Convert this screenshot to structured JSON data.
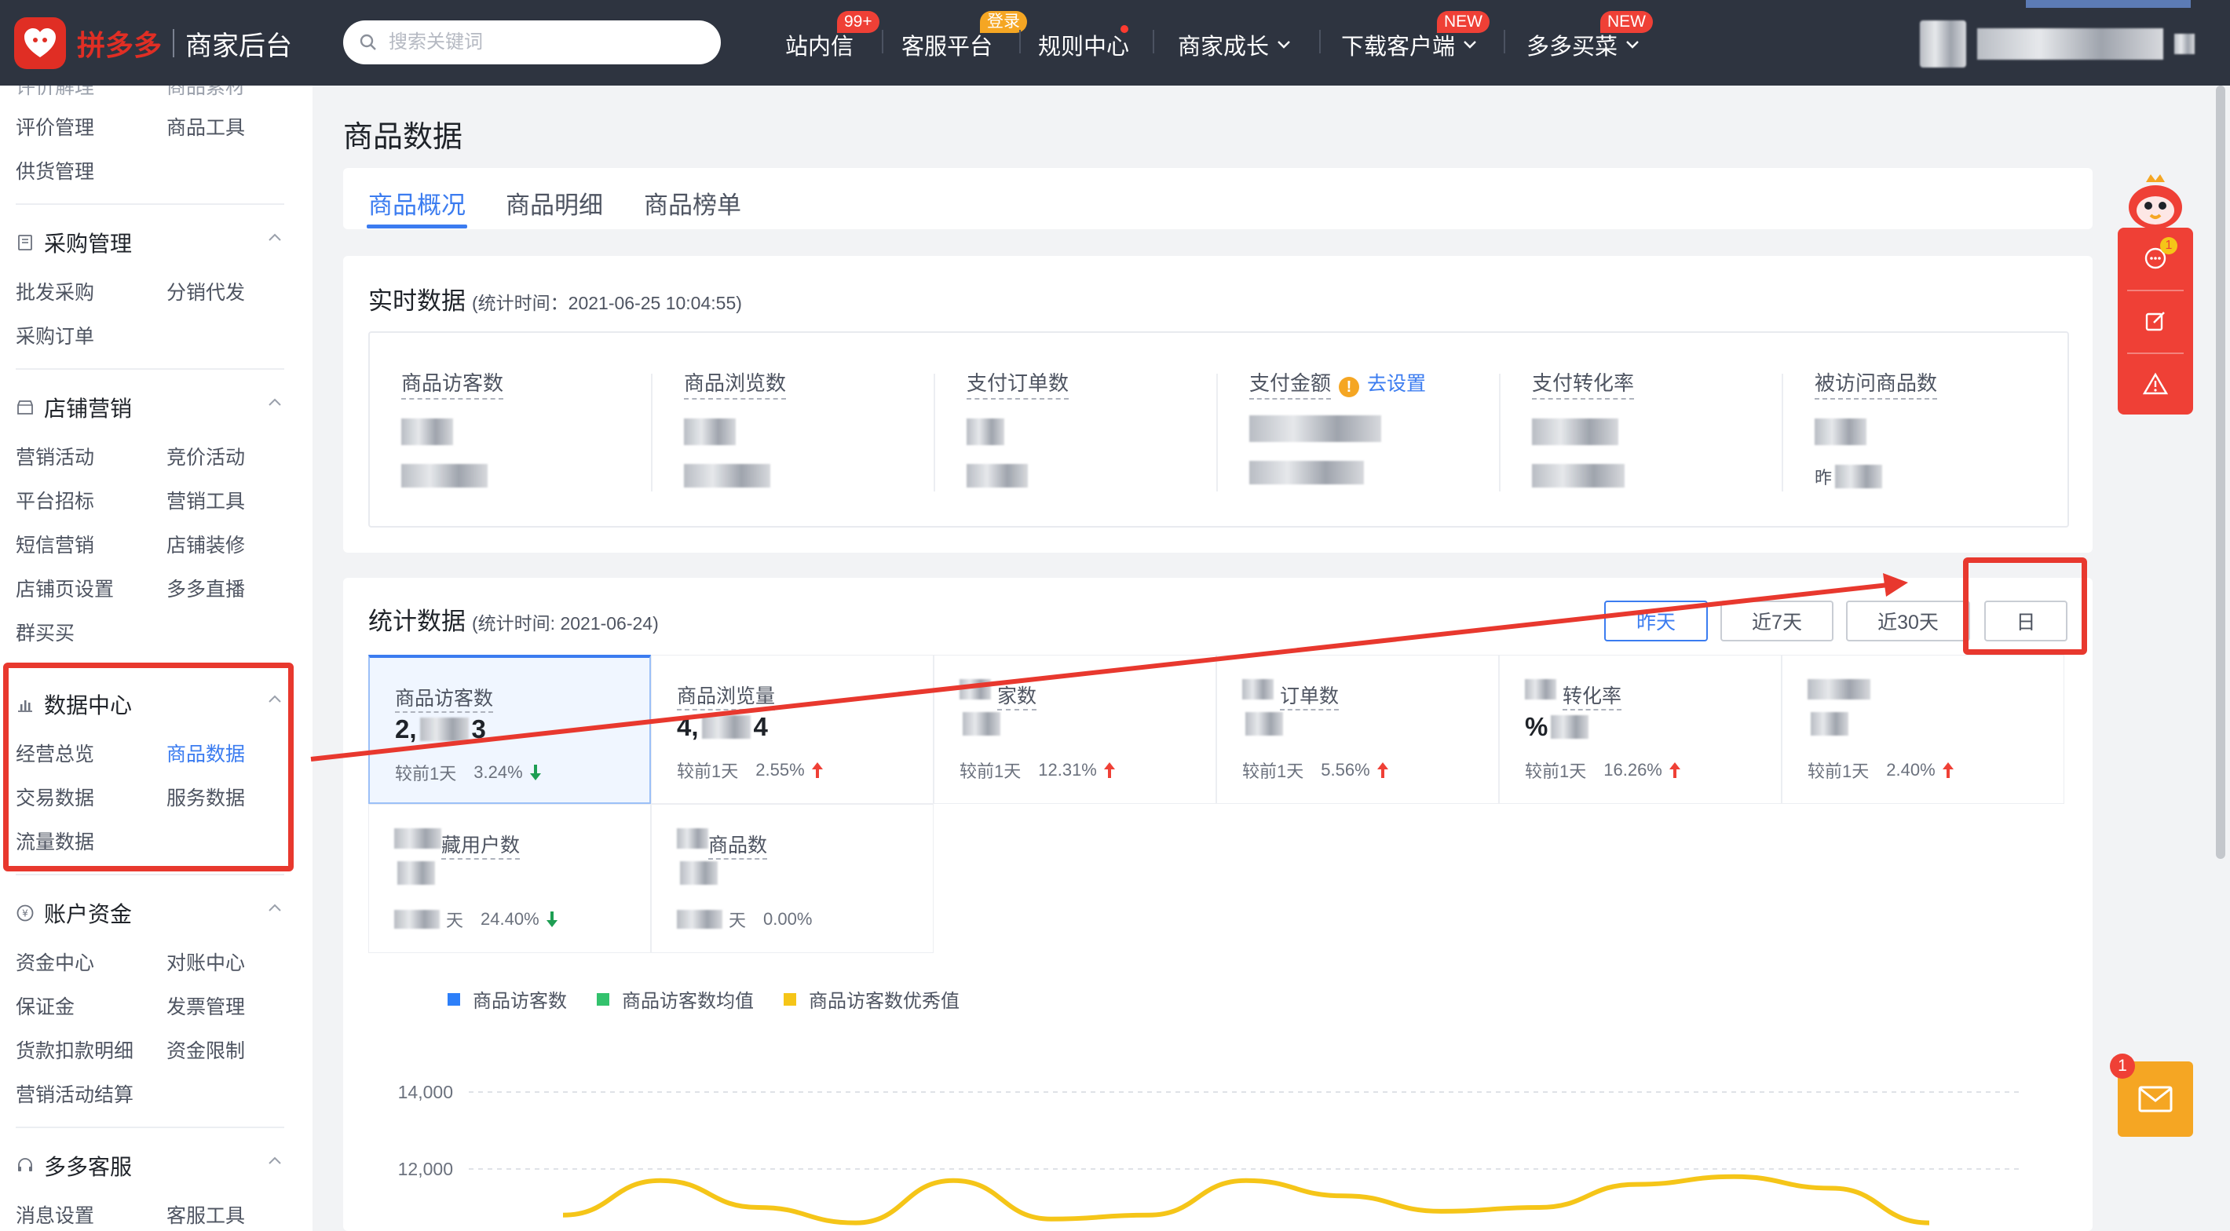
{
  "header": {
    "brand_name": "拼多多",
    "brand_sub": "商家后台",
    "search_placeholder": "搜索关键词",
    "nav": [
      {
        "label": "站内信",
        "badge": "99+"
      },
      {
        "label": "客服平台",
        "badge": "登录"
      },
      {
        "label": "规则中心"
      },
      {
        "label": "商家成长"
      },
      {
        "label": "下载客户端",
        "badge": "NEW"
      },
      {
        "label": "多多买菜",
        "badge": "NEW"
      }
    ]
  },
  "sidebar": {
    "top_rows": [
      [
        "评价管理",
        "商品工具"
      ],
      [
        "供货管理",
        ""
      ]
    ],
    "sections": [
      {
        "title": "采购管理",
        "rows": [
          [
            "批发采购",
            "分销代发"
          ],
          [
            "采购订单",
            ""
          ]
        ]
      },
      {
        "title": "店铺营销",
        "rows": [
          [
            "营销活动",
            "竞价活动"
          ],
          [
            "平台招标",
            "营销工具"
          ],
          [
            "短信营销",
            "店铺装修"
          ],
          [
            "店铺页设置",
            "多多直播"
          ],
          [
            "群买买",
            ""
          ]
        ]
      },
      {
        "title": "数据中心",
        "rows": [
          [
            "经营总览",
            "商品数据"
          ],
          [
            "交易数据",
            "服务数据"
          ],
          [
            "流量数据",
            ""
          ]
        ]
      },
      {
        "title": "账户资金",
        "rows": [
          [
            "资金中心",
            "对账中心"
          ],
          [
            "保证金",
            "发票管理"
          ],
          [
            "货款扣款明细",
            "资金限制"
          ],
          [
            "营销活动结算",
            ""
          ]
        ]
      },
      {
        "title": "多多客服",
        "rows": [
          [
            "消息设置",
            "客服工具"
          ]
        ]
      }
    ]
  },
  "page": {
    "title": "商品数据",
    "tabs": [
      "商品概况",
      "商品明细",
      "商品榜单"
    ]
  },
  "realtime": {
    "title": "实时数据",
    "subtitle": "(统计时间：2021-06-25 10:04:55)",
    "metrics": [
      "商品访客数",
      "商品浏览数",
      "支付订单数",
      "支付金额",
      "支付转化率",
      "被访问商品数"
    ],
    "set_link": "去设置",
    "yesterday_prefix": "昨"
  },
  "stats": {
    "title": "统计数据",
    "subtitle": "(统计时间: 2021-06-24)",
    "ranges": [
      "昨天",
      "近7天",
      "近30天",
      "日"
    ],
    "compare_label": "较前1天",
    "metrics": [
      {
        "label": "商品访客数",
        "value": "2,",
        "value_tail": "3",
        "pct": "3.24%",
        "trend": "down"
      },
      {
        "label": "商品浏览量",
        "value": "4,",
        "value_tail": "4",
        "pct": "2.55%",
        "trend": "up"
      },
      {
        "label": "家数",
        "value": "",
        "pct": "12.31%",
        "trend": "up"
      },
      {
        "label": "订单数",
        "value": "",
        "pct": "5.56%",
        "trend": "up"
      },
      {
        "label": "转化率",
        "value": "%",
        "pct": "16.26%",
        "trend": "up"
      },
      {
        "label": "",
        "value": "",
        "pct": "2.40%",
        "trend": "up"
      },
      {
        "label": "藏用户数",
        "value": "",
        "pct": "24.40%",
        "trend": "down"
      },
      {
        "label": "商品数",
        "value": "",
        "pct": "0.00%",
        "trend": "none"
      }
    ],
    "compare_short": "天"
  },
  "chart_data": {
    "type": "line",
    "legend": [
      "商品访客数",
      "商品访客数均值",
      "商品访客数优秀值"
    ],
    "colors": {
      "series1": "#2d7ff9",
      "series2": "#33c26d",
      "series3": "#f5c518"
    },
    "y_ticks": [
      "14,000",
      "12,000"
    ],
    "series": [
      {
        "name": "商品访客数优秀值",
        "values": [
          10800,
          11700,
          11000,
          10600,
          11700,
          10700,
          10800,
          11700,
          11300,
          10900,
          11000,
          11600,
          11800,
          11500,
          10600
        ]
      }
    ]
  },
  "float": {
    "mail_badge": "1",
    "chat_badge": "1"
  },
  "colors": {
    "accent": "#3b7cf0",
    "brand": "#e02e24",
    "up": "#ef4036",
    "down": "#1e9e53"
  }
}
